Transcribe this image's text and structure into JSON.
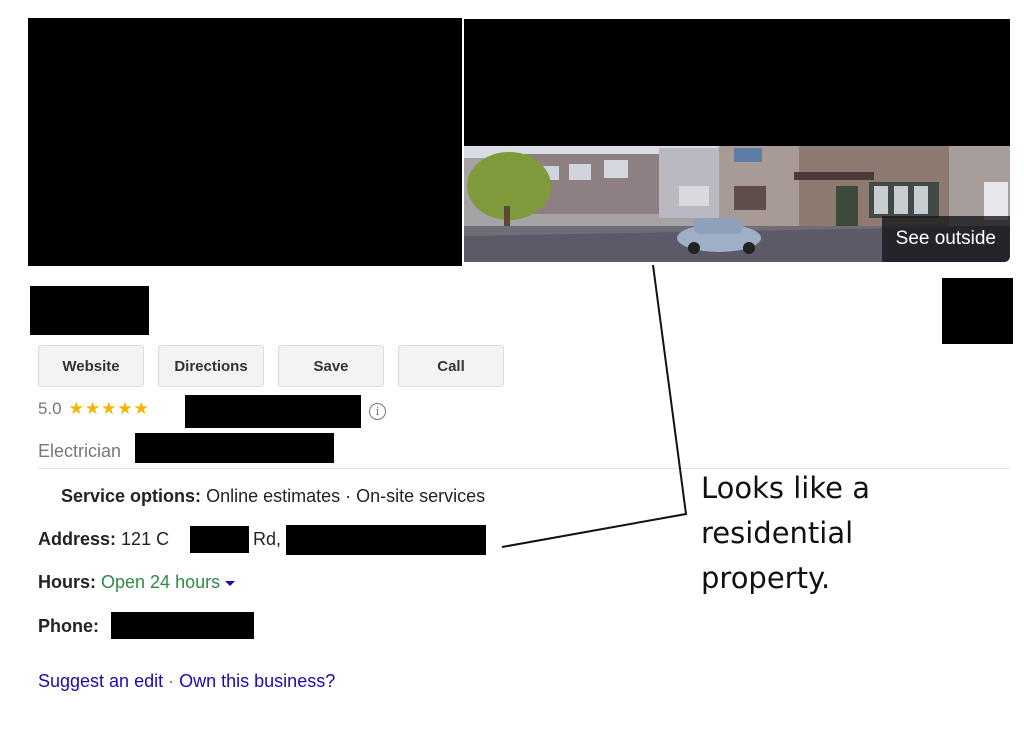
{
  "photo": {
    "see_outside_label": "See outside"
  },
  "actions": {
    "buttons": [
      {
        "label": "Website"
      },
      {
        "label": "Directions"
      },
      {
        "label": "Save"
      },
      {
        "label": "Call"
      }
    ]
  },
  "rating": {
    "score": "5.0",
    "stars": "★★★★★",
    "star_count": 5,
    "star_color": "#f4b400"
  },
  "category": "Electrician",
  "details": {
    "service_options_label": "Service options:",
    "service_options_value": "Online estimates · On-site services",
    "address_label": "Address:",
    "address_prefix": "121 C",
    "address_middle": "Rd,",
    "hours_label": "Hours:",
    "hours_value": "Open 24 hours",
    "hours_color": "#2e8b47",
    "phone_label": "Phone:"
  },
  "links": {
    "suggest_edit": "Suggest an edit",
    "separator": "·",
    "own_business": "Own this business?",
    "link_color": "#1a0dab"
  },
  "annotation": {
    "line1": "Looks like a",
    "line2": "residential",
    "line3": "property."
  }
}
